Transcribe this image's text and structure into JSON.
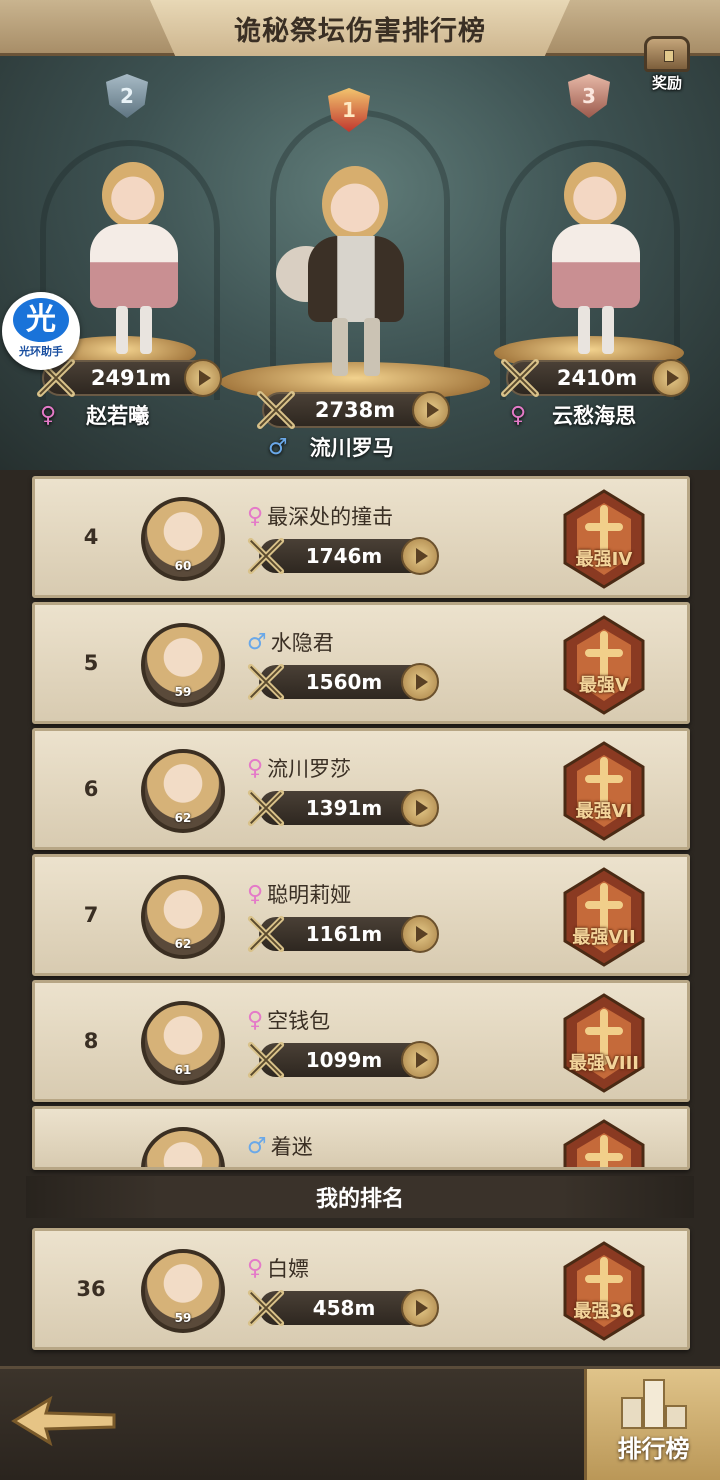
{
  "header": {
    "title": "诡秘祭坛伤害排行榜"
  },
  "reward": {
    "label": "奖励"
  },
  "helper": {
    "char": "光",
    "label": "光环助手"
  },
  "podium": [
    {
      "rank": "2",
      "value": "2491m",
      "name": "赵若曦",
      "gender": "female"
    },
    {
      "rank": "1",
      "value": "2738m",
      "name": "流川罗马",
      "gender": "male"
    },
    {
      "rank": "3",
      "value": "2410m",
      "name": "云愁海思",
      "gender": "female"
    }
  ],
  "rows": [
    {
      "rank": "4",
      "level": "60",
      "name": "最深处的撞击",
      "gender": "female",
      "value": "1746m",
      "title": "最强IV"
    },
    {
      "rank": "5",
      "level": "59",
      "name": "水隐君",
      "gender": "male",
      "value": "1560m",
      "title": "最强V"
    },
    {
      "rank": "6",
      "level": "62",
      "name": "流川罗莎",
      "gender": "female",
      "value": "1391m",
      "title": "最强VI"
    },
    {
      "rank": "7",
      "level": "62",
      "name": "聪明莉娅",
      "gender": "female",
      "value": "1161m",
      "title": "最强VII"
    },
    {
      "rank": "8",
      "level": "61",
      "name": "空钱包",
      "gender": "female",
      "value": "1099m",
      "title": "最强VIII"
    },
    {
      "rank": "",
      "level": "",
      "name": "着迷",
      "gender": "male",
      "value": "",
      "title": ""
    }
  ],
  "gender_symbols": {
    "female": "♀",
    "male": "♂"
  },
  "mine": {
    "header": "我的排名",
    "rank": "36",
    "level": "59",
    "name": "白嫖",
    "gender": "female",
    "value": "458m",
    "title": "最强36"
  },
  "bottom": {
    "ranking_label": "排行榜"
  },
  "colors": {
    "accent": "#d6b278",
    "female": "#e47ac8",
    "male": "#6aa8e8",
    "panel": "#ece2cd"
  }
}
